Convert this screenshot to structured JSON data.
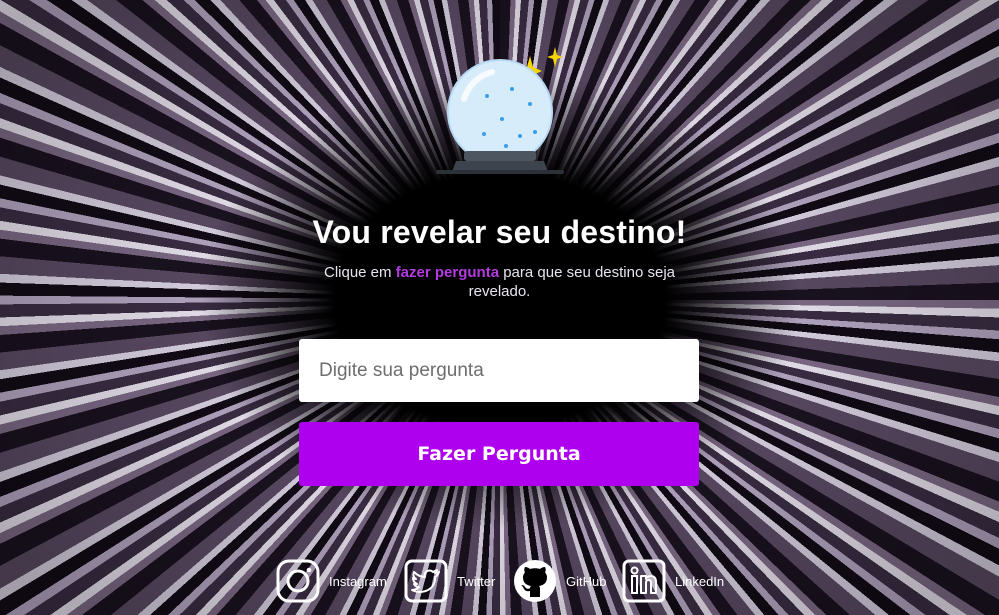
{
  "header": {
    "title": "Vou revelar seu destino!",
    "subtitle_prefix": "Clique em ",
    "subtitle_highlight": "fazer pergunta",
    "subtitle_suffix": " para que seu destino seja revelado."
  },
  "form": {
    "question_placeholder": "Digite sua pergunta",
    "question_value": "",
    "ask_button_label": "Fazer Pergunta"
  },
  "social": [
    {
      "label": "Instagram",
      "icon": "instagram-icon"
    },
    {
      "label": "Twitter",
      "icon": "twitter-icon"
    },
    {
      "label": "GitHub",
      "icon": "github-icon"
    },
    {
      "label": "LinkedIn",
      "icon": "linkedin-icon"
    }
  ],
  "colors": {
    "accent": "#ae00ee",
    "highlight_text": "#b43be0",
    "input_background": "#ffffff"
  },
  "logo": {
    "icon": "crystal-ball-icon"
  }
}
